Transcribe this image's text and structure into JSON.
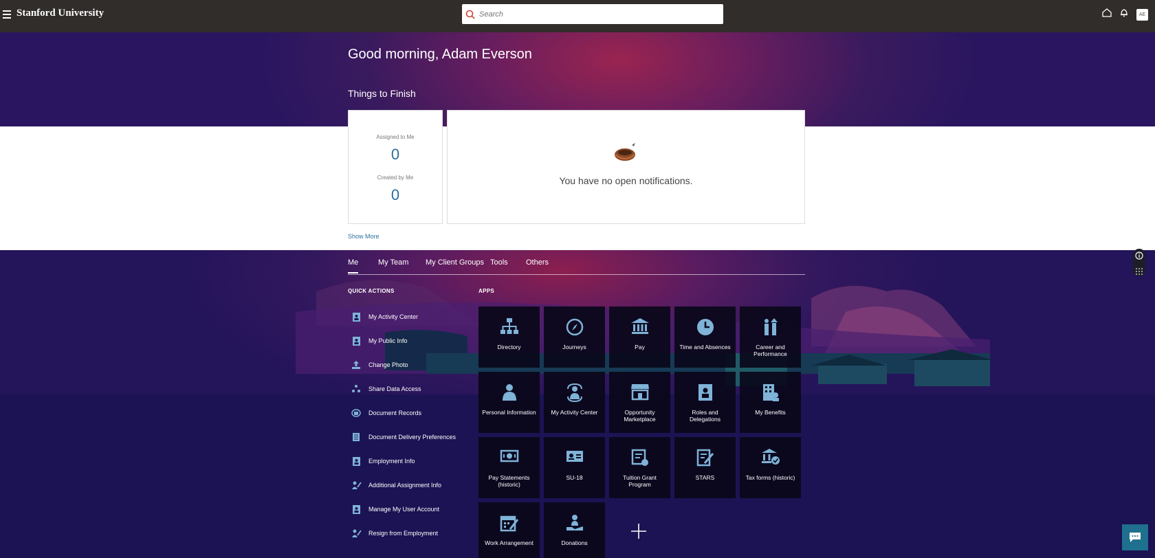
{
  "header": {
    "brand": "Stanford University",
    "search_placeholder": "Search",
    "avatar_initials": "AE"
  },
  "hero": {
    "greeting": "Good morning, Adam Everson",
    "section_title": "Things to Finish"
  },
  "things_to_finish": {
    "assigned_label": "Assigned to Me",
    "assigned_count": "0",
    "created_label": "Created by Me",
    "created_count": "0",
    "notifications_message": "You have no open notifications.",
    "show_more": "Show More"
  },
  "tabs": [
    "Me",
    "My Team",
    "My Client Groups",
    "Tools",
    "Others"
  ],
  "quick_actions": {
    "title": "QUICK ACTIONS",
    "items": [
      "My Activity Center",
      "My Public Info",
      "Change Photo",
      "Share Data Access",
      "Document Records",
      "Document Delivery Preferences",
      "Employment Info",
      "Additional Assignment Info",
      "Manage My User Account",
      "Resign from Employment"
    ]
  },
  "apps": {
    "title": "APPS",
    "tiles": [
      "Directory",
      "Journeys",
      "Pay",
      "Time and Absences",
      "Career and Performance",
      "Personal Information",
      "My Activity Center",
      "Opportunity Marketplace",
      "Roles and Delegations",
      "My Benefits",
      "Pay Statements (historic)",
      "SU-18",
      "Tuition Grant Program",
      "STARS",
      "Tax forms (historic)",
      "Work Arrangement",
      "Donations"
    ]
  },
  "colors": {
    "topbar": "#312d2a",
    "accent_blue": "#2d6e9e",
    "icon_blue": "#7fb3d8",
    "chat_button": "#1f6f8f"
  }
}
